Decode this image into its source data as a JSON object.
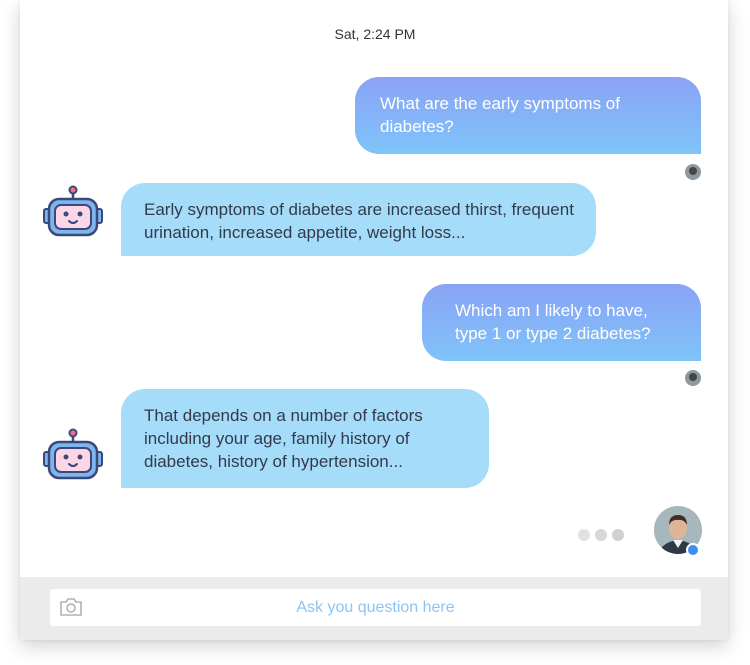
{
  "timestamp": "Sat, 2:24 PM",
  "messages": [
    {
      "sender": "user",
      "text": "What are the early symptoms of diabetes?"
    },
    {
      "sender": "bot",
      "text": "Early symptoms of diabetes are increased thirst, frequent urination, increased appetite, weight loss..."
    },
    {
      "sender": "user",
      "text": "Which am I likely to have, type 1 or type 2 diabetes?"
    },
    {
      "sender": "bot",
      "text": "That depends on a number of factors including your age, family history of diabetes, history of hypertension..."
    }
  ],
  "input": {
    "placeholder": "Ask you question here"
  },
  "icons": {
    "bot": "robot-icon",
    "attach": "camera-icon",
    "user": "user-avatar"
  },
  "colors": {
    "user_bubble_top": "#8aa2f4",
    "user_bubble_bottom": "#7fc4fa",
    "bot_bubble": "#a4dcfa",
    "placeholder": "#8dc4f4",
    "online_indicator": "#3d8ef0"
  }
}
